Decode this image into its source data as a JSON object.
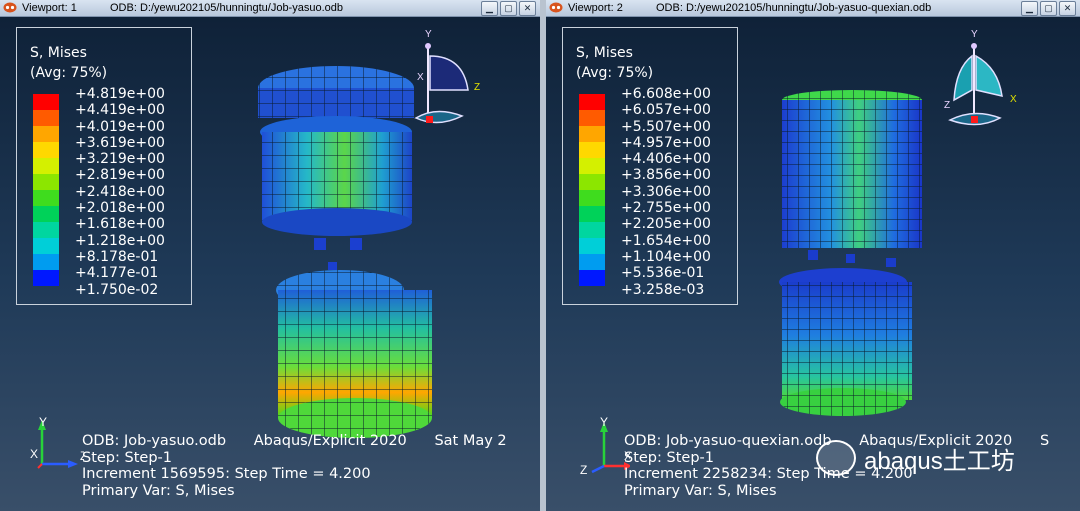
{
  "viewports": [
    {
      "label": "Viewport: 1",
      "odb_path": "ODB: D:/yewu202105/hunningtu/Job-yasuo.odb",
      "legend": {
        "title": "S, Mises",
        "avg": "(Avg: 75%)",
        "values": [
          "+4.819e+00",
          "+4.419e+00",
          "+4.019e+00",
          "+3.619e+00",
          "+3.219e+00",
          "+2.819e+00",
          "+2.418e+00",
          "+2.018e+00",
          "+1.618e+00",
          "+1.218e+00",
          "+8.178e-01",
          "+4.177e-01",
          "+1.750e-02"
        ]
      },
      "info": {
        "odb": "ODB: Job-yasuo.odb",
        "solver": "Abaqus/Explicit 2020",
        "date": "Sat May 2",
        "step": "Step: Step-1",
        "increment": "Increment    1569595: Step Time =      4.200",
        "primary": "Primary Var: S, Mises"
      },
      "triad_labels": {
        "y": "Y",
        "x": "X",
        "z": "Z"
      },
      "orient_labels": {
        "y": "Y",
        "x": "X",
        "z": "Z"
      }
    },
    {
      "label": "Viewport: 2",
      "odb_path": "ODB: D:/yewu202105/hunningtu/Job-yasuo-quexian.odb",
      "legend": {
        "title": "S, Mises",
        "avg": "(Avg: 75%)",
        "values": [
          "+6.608e+00",
          "+6.057e+00",
          "+5.507e+00",
          "+4.957e+00",
          "+4.406e+00",
          "+3.856e+00",
          "+3.306e+00",
          "+2.755e+00",
          "+2.205e+00",
          "+1.654e+00",
          "+1.104e+00",
          "+5.536e-01",
          "+3.258e-03"
        ]
      },
      "info": {
        "odb": "ODB: Job-yasuo-quexian.odb",
        "solver": "Abaqus/Explicit 2020",
        "date": "S",
        "step": "Step: Step-1",
        "increment": "Increment    2258234: Step Time =      4.200",
        "primary": "Primary Var: S, Mises"
      },
      "triad_labels": {
        "y": "Y",
        "x": "X",
        "z": "Z"
      },
      "orient_labels": {
        "y": "Y",
        "x": "X",
        "z": "Z"
      }
    }
  ],
  "watermark": "abaqus土工坊",
  "colors": {
    "contour": [
      "#ff0000",
      "#ff5b00",
      "#ffa600",
      "#ffd800",
      "#d4f000",
      "#8ce600",
      "#3fdc1e",
      "#00d259",
      "#00d6a0",
      "#00cfd8",
      "#009cf0",
      "#005cf8",
      "#0018ff"
    ]
  }
}
